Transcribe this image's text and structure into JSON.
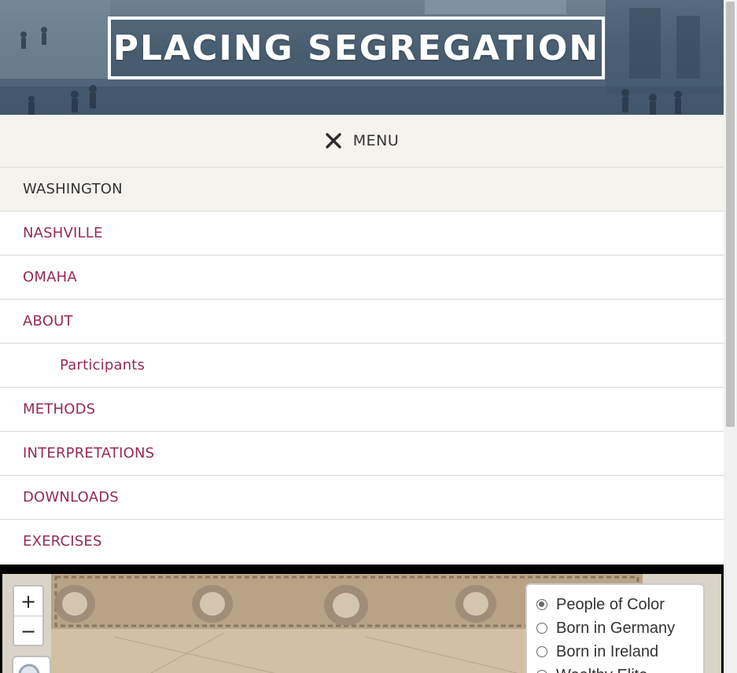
{
  "site": {
    "title": "PLACING SEGREGATION"
  },
  "menu": {
    "close_icon": "close-icon",
    "label": "MENU"
  },
  "nav": {
    "items": [
      {
        "label": "WASHINGTON",
        "state": "active"
      },
      {
        "label": "NASHVILLE"
      },
      {
        "label": "OMAHA"
      },
      {
        "label": "ABOUT"
      },
      {
        "label": "Participants",
        "level": "sub"
      },
      {
        "label": "METHODS"
      },
      {
        "label": "INTERPRETATIONS"
      },
      {
        "label": "DOWNLOADS"
      },
      {
        "label": "EXERCISES"
      }
    ]
  },
  "map": {
    "zoom_in": "+",
    "zoom_out": "−",
    "search_icon": "magnifier-icon",
    "layers": [
      {
        "label": "People of Color",
        "checked": true
      },
      {
        "label": "Born in Germany",
        "checked": false
      },
      {
        "label": "Born in Ireland",
        "checked": false
      },
      {
        "label": "Wealthy Elite",
        "checked": false
      }
    ]
  },
  "colors": {
    "link": "#962a57",
    "active_bg": "#f5f3ee",
    "banner": "#54697d"
  }
}
